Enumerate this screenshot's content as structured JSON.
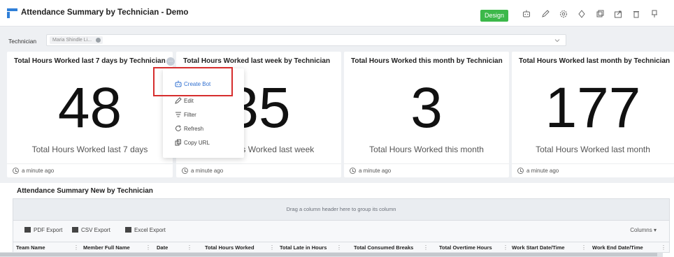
{
  "header": {
    "title": "Attendance Summary by Technician - Demo",
    "design_label": "Design",
    "icons": [
      "bot-icon",
      "edit-icon",
      "settings-icon",
      "refresh-icon",
      "copy-icon",
      "share-icon",
      "delete-icon",
      "pin-icon"
    ]
  },
  "filter": {
    "label": "Technician",
    "chip": "Maria Shindle Li..."
  },
  "cards": [
    {
      "title": "Total Hours Worked last 7 days by Technician",
      "value": "48",
      "caption": "Total Hours Worked last 7 days",
      "updated": "a minute ago"
    },
    {
      "title": "Total Hours Worked last week by Technician",
      "value": "35",
      "caption": "Total Hours Worked last week",
      "updated": "a minute ago"
    },
    {
      "title": "Total Hours Worked this month by Technician",
      "value": "3",
      "caption": "Total Hours Worked this month",
      "updated": "a minute ago"
    },
    {
      "title": "Total Hours Worked last month by Technician",
      "value": "177",
      "caption": "Total Hours Worked last month",
      "updated": "a minute ago"
    }
  ],
  "menu": {
    "more_label": "...",
    "items": [
      {
        "label": "Create Bot",
        "icon": "bot-icon"
      },
      {
        "label": "Edit",
        "icon": "edit-icon"
      },
      {
        "label": "Filter",
        "icon": "filter-icon"
      },
      {
        "label": "Refresh",
        "icon": "refresh-icon"
      },
      {
        "label": "Copy URL",
        "icon": "copy-icon"
      }
    ]
  },
  "grid": {
    "title": "Attendance Summary New by Technician",
    "group_hint": "Drag a column header here to group its column",
    "exports": [
      "PDF Export",
      "CSV Export",
      "Excel Export"
    ],
    "columns_label": "Columns ▾",
    "columns": [
      "Team Name",
      "Member Full Name",
      "Date",
      "Total Hours Worked",
      "Total Late in Hours",
      "Total Consumed Breaks",
      "Total Overtime Hours",
      "Work Start Date/Time",
      "Work End Date/Time"
    ]
  },
  "colors": {
    "accent": "#2f7fd8",
    "design_button": "#3cb84a",
    "highlight": "#d62d2d"
  }
}
